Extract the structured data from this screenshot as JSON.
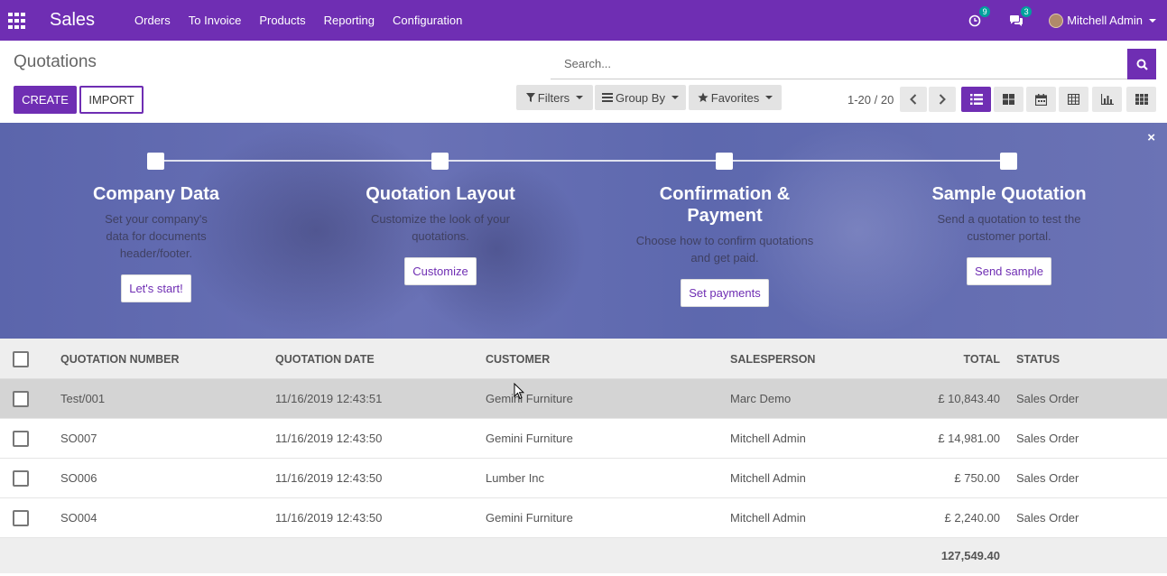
{
  "navbar": {
    "brand": "Sales",
    "menu": [
      "Orders",
      "To Invoice",
      "Products",
      "Reporting",
      "Configuration"
    ],
    "activity_count": "9",
    "messages_count": "3",
    "user": "Mitchell Admin"
  },
  "control": {
    "breadcrumb": "Quotations",
    "search_placeholder": "Search...",
    "create_label": "CREATE",
    "import_label": "IMPORT",
    "filters_label": "Filters",
    "groupby_label": "Group By",
    "favorites_label": "Favorites",
    "pager": "1-20 / 20"
  },
  "banner": {
    "steps": [
      {
        "title": "Company Data",
        "desc": "Set your company's data for documents header/footer.",
        "button": "Let's start!"
      },
      {
        "title": "Quotation Layout",
        "desc": "Customize the look of your quotations.",
        "button": "Customize"
      },
      {
        "title": "Confirmation & Payment",
        "desc": "Choose how to confirm quotations and get paid.",
        "button": "Set payments"
      },
      {
        "title": "Sample Quotation",
        "desc": "Send a quotation to test the customer portal.",
        "button": "Send sample"
      }
    ],
    "close": "×"
  },
  "table": {
    "headers": {
      "number": "QUOTATION NUMBER",
      "date": "QUOTATION DATE",
      "customer": "CUSTOMER",
      "salesperson": "SALESPERSON",
      "total": "TOTAL",
      "status": "STATUS"
    },
    "rows": [
      {
        "number": "Test/001",
        "date": "11/16/2019 12:43:51",
        "customer": "Gemini Furniture",
        "salesperson": "Marc Demo",
        "total": "£ 10,843.40",
        "status": "Sales Order"
      },
      {
        "number": "SO007",
        "date": "11/16/2019 12:43:50",
        "customer": "Gemini Furniture",
        "salesperson": "Mitchell Admin",
        "total": "£ 14,981.00",
        "status": "Sales Order"
      },
      {
        "number": "SO006",
        "date": "11/16/2019 12:43:50",
        "customer": "Lumber Inc",
        "salesperson": "Mitchell Admin",
        "total": "£ 750.00",
        "status": "Sales Order"
      },
      {
        "number": "SO004",
        "date": "11/16/2019 12:43:50",
        "customer": "Gemini Furniture",
        "salesperson": "Mitchell Admin",
        "total": "£ 2,240.00",
        "status": "Sales Order"
      }
    ],
    "footer_total": "127,549.40"
  },
  "colors": {
    "brand": "#6f2eb3"
  }
}
